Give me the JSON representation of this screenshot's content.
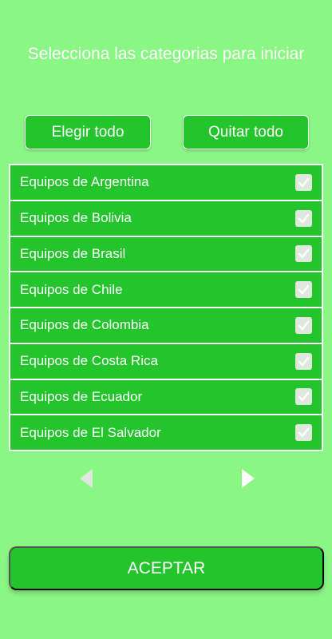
{
  "header": {
    "title": "Selecciona las categorias para iniciar"
  },
  "toolbar": {
    "select_all_label": "Elegir todo",
    "clear_all_label": "Quitar todo"
  },
  "categories": [
    {
      "label": "Equipos de Argentina",
      "checked": true
    },
    {
      "label": "Equipos de Bolivia",
      "checked": true
    },
    {
      "label": "Equipos de Brasil",
      "checked": true
    },
    {
      "label": "Equipos de Chile",
      "checked": true
    },
    {
      "label": "Equipos de Colombia",
      "checked": true
    },
    {
      "label": "Equipos de Costa Rica",
      "checked": true
    },
    {
      "label": "Equipos de Ecuador",
      "checked": true
    },
    {
      "label": "Equipos de El Salvador",
      "checked": true
    }
  ],
  "pager": {
    "prev_icon": "chevron-left-icon",
    "next_icon": "chevron-right-icon",
    "prev_enabled": false,
    "next_enabled": true
  },
  "footer": {
    "accept_label": "ACEPTAR"
  },
  "colors": {
    "background": "#8af784",
    "accent": "#24c42c",
    "text": "#ffffff",
    "disabled_arrow": "#dfe7df"
  }
}
